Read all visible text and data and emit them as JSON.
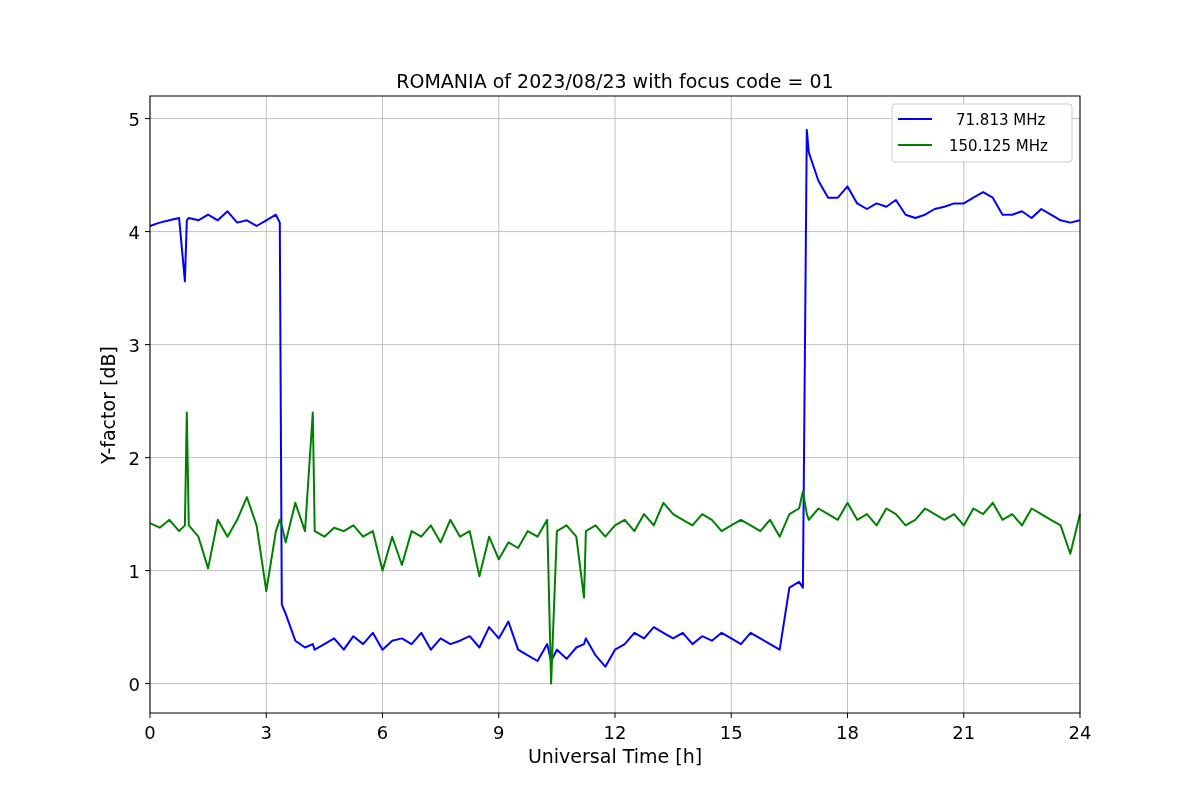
{
  "figure": {
    "chart_data": {
      "type": "line",
      "grid": true,
      "legend": "upper right",
      "title": "ROMANIA of 2023/08/23 with focus code = 01",
      "xlabel": "Universal Time [h]",
      "ylabel": "Y-factor [dB]",
      "xlim": [
        0,
        24
      ],
      "ylim": [
        -0.26,
        5.2
      ],
      "xticks": [
        0,
        3,
        6,
        9,
        12,
        15,
        18,
        21,
        24
      ],
      "yticks": [
        0,
        1,
        2,
        3,
        4,
        5
      ],
      "x": [
        0,
        0.25,
        0.5,
        0.75,
        0.9,
        0.95,
        1,
        1.25,
        1.5,
        1.75,
        2,
        2.25,
        2.5,
        2.75,
        3,
        3.25,
        3.35,
        3.4,
        3.5,
        3.75,
        4,
        4.2,
        4.25,
        4.5,
        4.75,
        5,
        5.25,
        5.5,
        5.75,
        6,
        6.25,
        6.5,
        6.75,
        7,
        7.25,
        7.5,
        7.75,
        8,
        8.25,
        8.5,
        8.75,
        9,
        9.25,
        9.5,
        9.75,
        10,
        10.25,
        10.35,
        10.5,
        10.75,
        11,
        11.2,
        11.25,
        11.5,
        11.75,
        12,
        12.25,
        12.5,
        12.75,
        13,
        13.25,
        13.5,
        13.75,
        14,
        14.25,
        14.5,
        14.75,
        15,
        15.25,
        15.5,
        15.75,
        16,
        16.25,
        16.5,
        16.75,
        16.85,
        16.95,
        17,
        17.25,
        17.5,
        17.75,
        18,
        18.25,
        18.5,
        18.75,
        19,
        19.25,
        19.5,
        19.75,
        20,
        20.25,
        20.5,
        20.75,
        21,
        21.25,
        21.5,
        21.75,
        22,
        22.25,
        22.5,
        22.75,
        23,
        23.25,
        23.5,
        23.75,
        24
      ],
      "series": [
        {
          "name": "71.813 MHz",
          "color": "#0000ff",
          "values": [
            4.05,
            4.08,
            4.1,
            4.12,
            3.56,
            4.1,
            4.12,
            4.1,
            4.15,
            4.1,
            4.18,
            4.08,
            4.1,
            4.05,
            4.1,
            4.15,
            4.08,
            0.7,
            0.62,
            0.38,
            0.32,
            0.35,
            0.3,
            0.35,
            0.4,
            0.3,
            0.42,
            0.35,
            0.45,
            0.3,
            0.38,
            0.4,
            0.35,
            0.45,
            0.3,
            0.4,
            0.35,
            0.38,
            0.42,
            0.32,
            0.5,
            0.4,
            0.55,
            0.3,
            0.25,
            0.2,
            0.35,
            0.2,
            0.3,
            0.22,
            0.32,
            0.35,
            0.4,
            0.25,
            0.15,
            0.3,
            0.35,
            0.45,
            0.4,
            0.5,
            0.45,
            0.4,
            0.45,
            0.35,
            0.42,
            0.38,
            0.45,
            0.4,
            0.35,
            0.45,
            0.4,
            0.35,
            0.3,
            0.85,
            0.9,
            0.85,
            4.9,
            4.7,
            4.45,
            4.3,
            4.3,
            4.4,
            4.25,
            4.2,
            4.25,
            4.22,
            4.28,
            4.15,
            4.12,
            4.15,
            4.2,
            4.22,
            4.25,
            4.25,
            4.3,
            4.35,
            4.3,
            4.15,
            4.15,
            4.18,
            4.12,
            4.2,
            4.15,
            4.1,
            4.08,
            4.1
          ]
        },
        {
          "name": "150.125 MHz",
          "color": "#008000",
          "values": [
            1.42,
            1.38,
            1.45,
            1.35,
            1.4,
            2.4,
            1.4,
            1.3,
            1.02,
            1.45,
            1.3,
            1.45,
            1.65,
            1.4,
            0.82,
            1.35,
            1.45,
            1.4,
            1.25,
            1.6,
            1.35,
            2.4,
            1.35,
            1.3,
            1.38,
            1.35,
            1.4,
            1.3,
            1.35,
            1.0,
            1.3,
            1.05,
            1.35,
            1.3,
            1.4,
            1.25,
            1.45,
            1.3,
            1.35,
            0.95,
            1.3,
            1.1,
            1.25,
            1.2,
            1.35,
            1.3,
            1.45,
            0.0,
            1.35,
            1.4,
            1.3,
            0.76,
            1.35,
            1.4,
            1.3,
            1.4,
            1.45,
            1.35,
            1.5,
            1.4,
            1.6,
            1.5,
            1.45,
            1.4,
            1.5,
            1.45,
            1.35,
            1.4,
            1.45,
            1.4,
            1.35,
            1.45,
            1.3,
            1.5,
            1.55,
            1.7,
            1.5,
            1.45,
            1.55,
            1.5,
            1.45,
            1.6,
            1.45,
            1.5,
            1.4,
            1.55,
            1.5,
            1.4,
            1.45,
            1.55,
            1.5,
            1.45,
            1.5,
            1.4,
            1.55,
            1.5,
            1.6,
            1.45,
            1.5,
            1.4,
            1.55,
            1.5,
            1.45,
            1.4,
            1.15,
            1.5
          ]
        }
      ]
    }
  }
}
